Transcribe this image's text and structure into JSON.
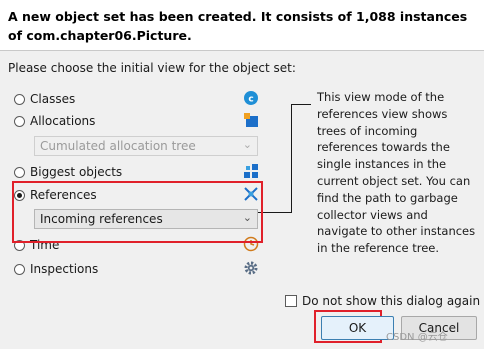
{
  "header": {
    "message": "A new object set has been created. It consists of 1,088 instances of com.chapter06.Picture."
  },
  "prompt": "Please choose the initial view for the object set:",
  "options": [
    {
      "label": "Classes",
      "checked": false,
      "icon": "classes-icon"
    },
    {
      "label": "Allocations",
      "checked": false,
      "icon": "allocations-icon"
    },
    {
      "label": "Biggest objects",
      "checked": false,
      "icon": "biggest-objects-icon"
    },
    {
      "label": "References",
      "checked": true,
      "icon": "references-icon"
    },
    {
      "label": "Time",
      "checked": false,
      "icon": "time-icon"
    },
    {
      "label": "Inspections",
      "checked": false,
      "icon": "inspections-icon"
    }
  ],
  "allocations_combo": {
    "value": "Cumulated allocation tree",
    "enabled": false
  },
  "references_combo": {
    "value": "Incoming references",
    "enabled": true
  },
  "description": "This view mode of the references view shows trees of incoming references towards the single instances in the current object set. You can find the path to garbage collector views and navigate to other instances in the reference tree.",
  "dont_show": {
    "label": "Do not show this dialog again",
    "checked": false
  },
  "buttons": {
    "ok": "OK",
    "cancel": "Cancel"
  },
  "watermark": "CSDN @云仓",
  "colors": {
    "highlight": "#e0202a",
    "classes_icon": "#1f8fd6",
    "allocations_icon": "#1c6fc9"
  }
}
